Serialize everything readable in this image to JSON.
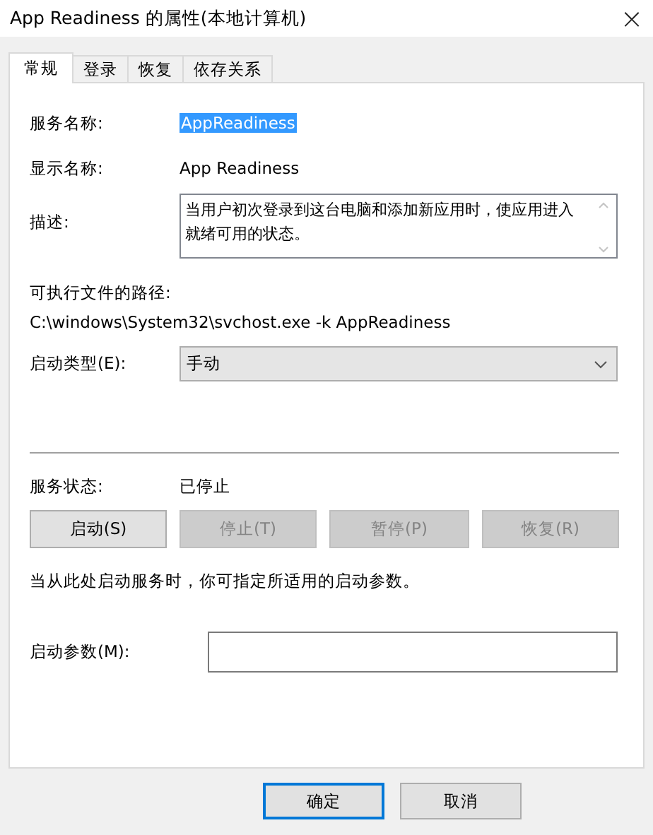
{
  "window": {
    "title": "App Readiness 的属性(本地计算机)",
    "close": "×"
  },
  "tabs": [
    {
      "label": "常规",
      "selected": true
    },
    {
      "label": "登录",
      "selected": false
    },
    {
      "label": "恢复",
      "selected": false
    },
    {
      "label": "依存关系",
      "selected": false
    }
  ],
  "service_name": {
    "label": "服务名称:",
    "value": "AppReadiness",
    "highlighted": true
  },
  "display_name": {
    "label": "显示名称:",
    "value": "App Readiness"
  },
  "description": {
    "label": "描述:",
    "value": "当用户初次登录到这台电脑和添加新应用时，使应用进入就绪可用的状态。"
  },
  "executable_path": {
    "label": "可执行文件的路径:",
    "value": "C:\\windows\\System32\\svchost.exe -k AppReadiness"
  },
  "startup_type": {
    "label": "启动类型(E):",
    "value": "手动"
  },
  "service_status": {
    "label": "服务状态:",
    "value": "已停止"
  },
  "control_buttons": [
    {
      "label": "启动(S)",
      "disabled": false
    },
    {
      "label": "停止(T)",
      "disabled": true
    },
    {
      "label": "暂停(P)",
      "disabled": true
    },
    {
      "label": "恢复(R)",
      "disabled": true
    }
  ],
  "hint": "当从此处启动服务时，你可指定所适用的启动参数。",
  "start_parameters": {
    "label": "启动参数(M):"
  },
  "dialog_buttons": [
    {
      "label": "确定",
      "default": true
    },
    {
      "label": "取消",
      "default": false
    }
  ]
}
